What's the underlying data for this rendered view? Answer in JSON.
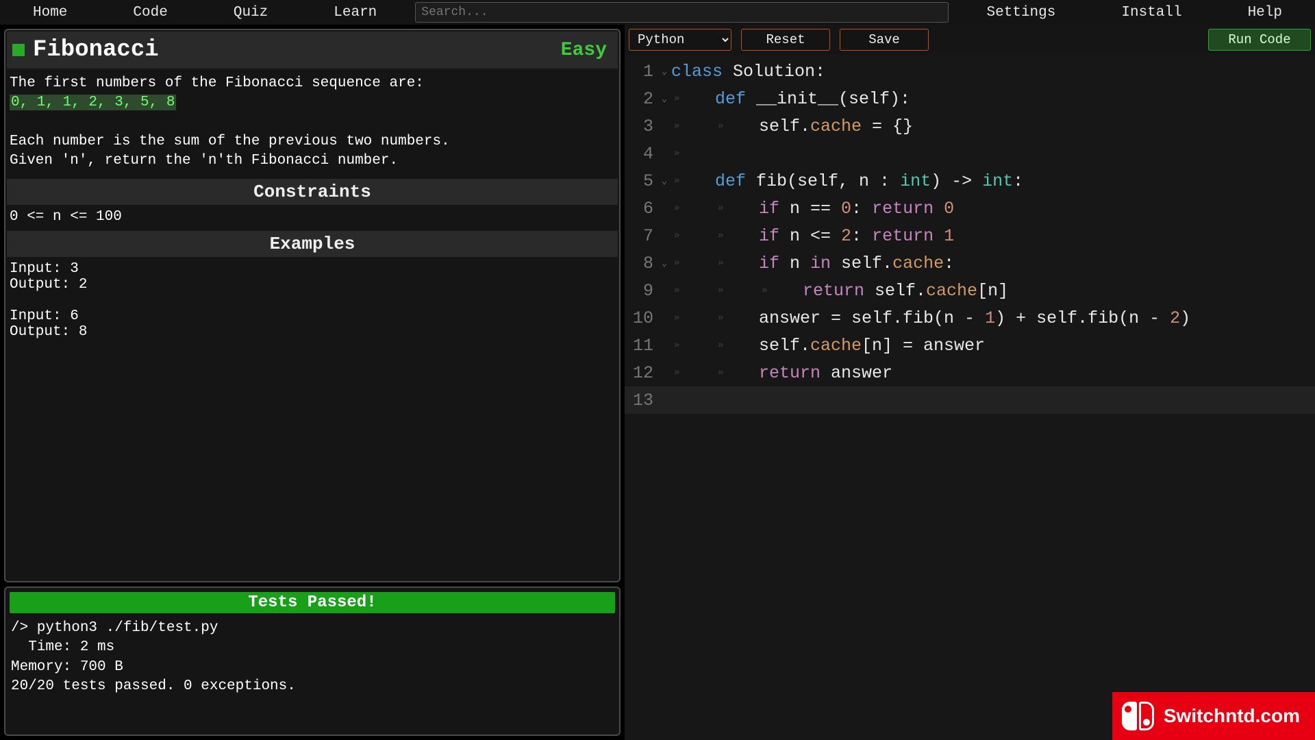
{
  "nav": {
    "left": [
      "Home",
      "Code",
      "Quiz",
      "Learn"
    ],
    "right": [
      "Settings",
      "Install",
      "Help"
    ],
    "search_placeholder": "Search..."
  },
  "problem": {
    "title": "Fibonacci",
    "difficulty": "Easy",
    "desc_line1": "The first numbers of the Fibonacci sequence are:",
    "desc_highlight": "0, 1, 1, 2, 3, 5, 8",
    "desc_line2": "Each number is the sum of the previous two numbers.",
    "desc_line3": "Given 'n', return the 'n'th Fibonacci number.",
    "constraints_h": "Constraints",
    "constraints": "0 <= n <= 100",
    "examples_h": "Examples",
    "examples": "Input: 3\nOutput: 2\n\nInput: 6\nOutput: 8"
  },
  "console": {
    "status": "Tests Passed!",
    "output": "/> python3 ./fib/test.py\n  Time: 2 ms\nMemory: 700 B\n20/20 tests passed. 0 exceptions."
  },
  "toolbar": {
    "language": "Python",
    "reset": "Reset",
    "save": "Save",
    "run": "Run Code"
  },
  "watermark": "Switchntd.com",
  "code": {
    "lines": [
      {
        "n": 1,
        "fold": true,
        "indent": 0,
        "tokens": [
          [
            "kw",
            "class "
          ],
          [
            "name",
            "Solution:"
          ]
        ]
      },
      {
        "n": 2,
        "fold": true,
        "indent": 1,
        "tokens": [
          [
            "def",
            "def "
          ],
          [
            "name",
            "__init__(self):"
          ]
        ]
      },
      {
        "n": 3,
        "fold": false,
        "indent": 2,
        "tokens": [
          [
            "name",
            "self."
          ],
          [
            "attr",
            "cache"
          ],
          [
            "name",
            " = {}"
          ]
        ]
      },
      {
        "n": 4,
        "fold": false,
        "indent": 1,
        "tokens": []
      },
      {
        "n": 5,
        "fold": true,
        "indent": 1,
        "tokens": [
          [
            "def",
            "def "
          ],
          [
            "name",
            "fib(self, n : "
          ],
          [
            "type",
            "int"
          ],
          [
            "name",
            ") -> "
          ],
          [
            "type",
            "int"
          ],
          [
            "name",
            ":"
          ]
        ]
      },
      {
        "n": 6,
        "fold": false,
        "indent": 2,
        "tokens": [
          [
            "pink",
            "if "
          ],
          [
            "name",
            "n == "
          ],
          [
            "num",
            "0"
          ],
          [
            "name",
            ": "
          ],
          [
            "pink",
            "return "
          ],
          [
            "num",
            "0"
          ]
        ]
      },
      {
        "n": 7,
        "fold": false,
        "indent": 2,
        "tokens": [
          [
            "pink",
            "if "
          ],
          [
            "name",
            "n <= "
          ],
          [
            "num",
            "2"
          ],
          [
            "name",
            ": "
          ],
          [
            "pink",
            "return "
          ],
          [
            "num",
            "1"
          ]
        ]
      },
      {
        "n": 8,
        "fold": true,
        "indent": 2,
        "tokens": [
          [
            "pink",
            "if "
          ],
          [
            "name",
            "n "
          ],
          [
            "pink",
            "in "
          ],
          [
            "name",
            "self."
          ],
          [
            "attr",
            "cache"
          ],
          [
            "name",
            ":"
          ]
        ]
      },
      {
        "n": 9,
        "fold": false,
        "indent": 3,
        "tokens": [
          [
            "pink",
            "return "
          ],
          [
            "name",
            "self."
          ],
          [
            "attr",
            "cache"
          ],
          [
            "name",
            "[n]"
          ]
        ]
      },
      {
        "n": 10,
        "fold": false,
        "indent": 2,
        "tokens": [
          [
            "name",
            "answer = self.fib(n - "
          ],
          [
            "num",
            "1"
          ],
          [
            "name",
            ") + self.fib(n - "
          ],
          [
            "num",
            "2"
          ],
          [
            "name",
            ")"
          ]
        ]
      },
      {
        "n": 11,
        "fold": false,
        "indent": 2,
        "tokens": [
          [
            "name",
            "self."
          ],
          [
            "attr",
            "cache"
          ],
          [
            "name",
            "[n] = answer"
          ]
        ]
      },
      {
        "n": 12,
        "fold": false,
        "indent": 2,
        "tokens": [
          [
            "pink",
            "return "
          ],
          [
            "name",
            "answer"
          ]
        ]
      },
      {
        "n": 13,
        "fold": false,
        "indent": 0,
        "tokens": [],
        "current": true
      }
    ]
  }
}
